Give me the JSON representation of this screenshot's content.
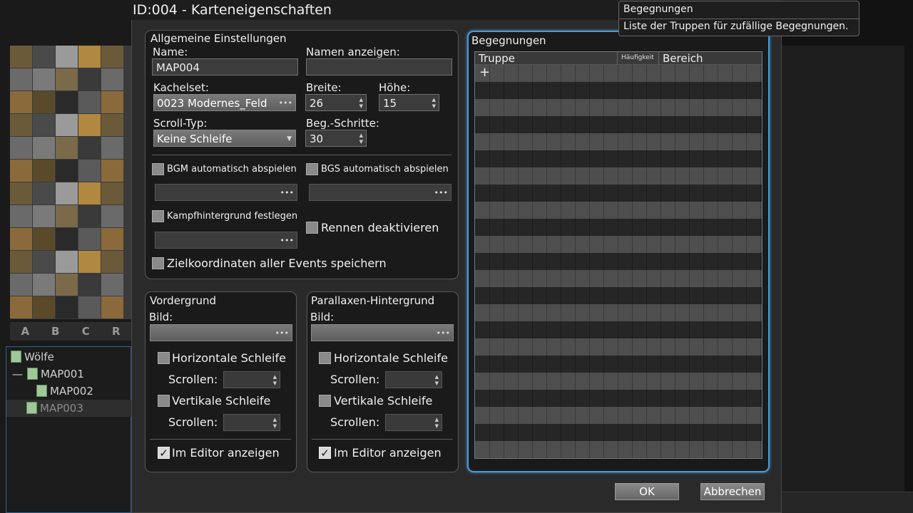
{
  "window": {
    "title": "ID:004 - Karteneigenschaften"
  },
  "tooltip": {
    "title": "Begegnungen",
    "text": "Liste der Truppen für zufällige Begegnungen."
  },
  "tileset_tabs": [
    "A",
    "B",
    "C",
    "R"
  ],
  "map_tree": [
    {
      "name": "Wölfe",
      "indent": 0,
      "prefix": ""
    },
    {
      "name": "MAP001",
      "indent": 1,
      "prefix": "—"
    },
    {
      "name": "MAP002",
      "indent": 2,
      "prefix": ""
    },
    {
      "name": "MAP003",
      "indent": 1,
      "prefix": ""
    }
  ],
  "general": {
    "group_label": "Allgemeine Einstellungen",
    "name_label": "Name:",
    "name_value": "MAP004",
    "display_name_label": "Namen anzeigen:",
    "display_name_value": "",
    "tileset_label": "Kachelset:",
    "tileset_value": "0023 Modernes_Feld",
    "width_label": "Breite:",
    "width_value": "26",
    "height_label": "Höhe:",
    "height_value": "15",
    "scroll_label": "Scroll-Typ:",
    "scroll_value": "Keine Schleife",
    "steps_label": "Beg.-Schritte:",
    "steps_value": "30",
    "bgm_label": "BGM automatisch abspielen",
    "bgs_label": "BGS automatisch abspielen",
    "battleback_label": "Kampfhintergrund festlegen",
    "disable_dash_label": "Rennen deaktivieren",
    "save_event_loc_label": "Zielkoordinaten aller Events speichern"
  },
  "foreground": {
    "group_label": "Vordergrund",
    "image_label": "Bild:",
    "hloop_label": "Horizontale Schleife",
    "scroll1_label": "Scrollen:",
    "vloop_label": "Vertikale Schleife",
    "scroll2_label": "Scrollen:",
    "show_editor_label": "Im Editor anzeigen"
  },
  "parallax": {
    "group_label": "Parallaxen-Hintergrund",
    "image_label": "Bild:",
    "hloop_label": "Horizontale Schleife",
    "scroll1_label": "Scrollen:",
    "vloop_label": "Vertikale Schleife",
    "scroll2_label": "Scrollen:",
    "show_editor_label": "Im Editor anzeigen"
  },
  "encounters": {
    "group_label": "Begegnungen",
    "columns": [
      "Truppe",
      "Häufigkeit",
      "Bereich"
    ],
    "add_symbol": "+"
  },
  "buttons": {
    "ok": "OK",
    "cancel": "Abbrechen"
  },
  "colors": {
    "accent_border": "#4a9ad8",
    "row_light": "#4e4e4e",
    "row_dark": "#262626"
  }
}
